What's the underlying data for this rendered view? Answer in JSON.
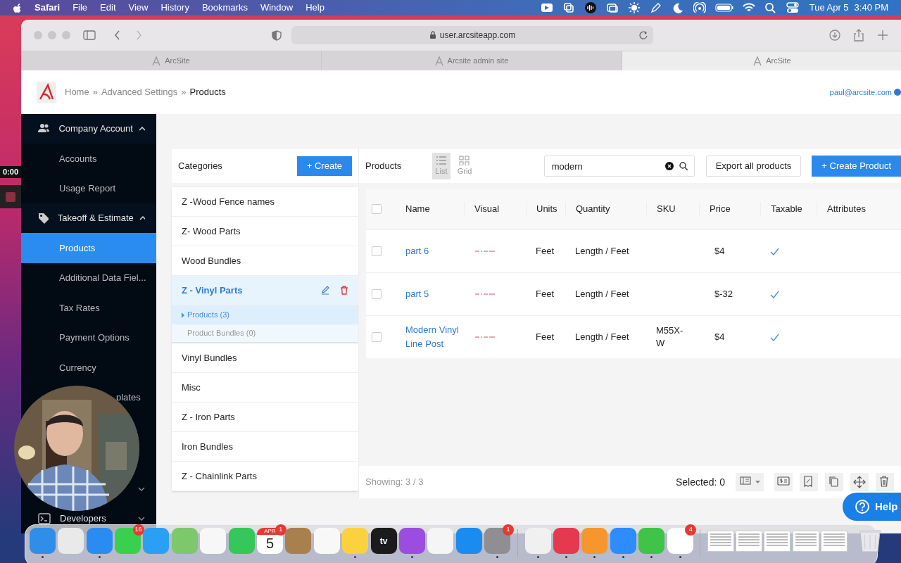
{
  "menu_bar": {
    "app": "Safari",
    "menus": [
      "File",
      "Edit",
      "View",
      "History",
      "Bookmarks",
      "Window",
      "Help"
    ],
    "date": "Tue Apr 5",
    "time": "3:40 PM"
  },
  "browser": {
    "address": "user.arcsiteapp.com",
    "tabs": [
      {
        "label": "ArcSite",
        "selected": false
      },
      {
        "label": "Arcsite admin site",
        "selected": false
      },
      {
        "label": "ArcSite",
        "selected": true
      }
    ]
  },
  "header": {
    "breadcrumb": [
      {
        "label": "Home",
        "current": false
      },
      {
        "label": "Advanced Settings",
        "current": false
      },
      {
        "label": "Products",
        "current": true
      }
    ],
    "separator": "»",
    "user": "paul@arcsite.com"
  },
  "sidebar": {
    "items": [
      {
        "kind": "section",
        "label": "Company Account",
        "expanded": true
      },
      {
        "kind": "link",
        "label": "Accounts",
        "selected": false
      },
      {
        "kind": "link",
        "label": "Usage Report",
        "selected": false
      },
      {
        "kind": "section",
        "label": "Takeoff & Estimate",
        "expanded": true
      },
      {
        "kind": "link",
        "label": "Products",
        "selected": true
      },
      {
        "kind": "link",
        "label": "Additional Data Fiel...",
        "selected": false
      },
      {
        "kind": "link",
        "label": "Tax Rates",
        "selected": false
      },
      {
        "kind": "link",
        "label": "Payment Options",
        "selected": false
      },
      {
        "kind": "link",
        "label": "Currency",
        "selected": false
      },
      {
        "kind": "partial",
        "label": "plates"
      },
      {
        "kind": "section",
        "expanded": false
      },
      {
        "kind": "section",
        "label": "Developers",
        "expanded": false
      }
    ]
  },
  "recorder": {
    "timer": "0:00"
  },
  "categories": {
    "title": "Categories",
    "create_label": "+ Create",
    "items": [
      {
        "label": "Z -Wood Fence names",
        "selected": false
      },
      {
        "label": "Z- Wood Parts",
        "selected": false
      },
      {
        "label": "Wood Bundles",
        "selected": false
      },
      {
        "label": "Z - Vinyl Parts",
        "selected": true,
        "children": [
          {
            "label": "Products (3)",
            "selected": true
          },
          {
            "label": "Product Bundles (0)",
            "selected": false
          }
        ]
      },
      {
        "label": "Vinyl Bundles",
        "selected": false
      },
      {
        "label": "Misc",
        "selected": false
      },
      {
        "label": "Z - Iron Parts",
        "selected": false
      },
      {
        "label": "Iron Bundles",
        "selected": false
      },
      {
        "label": "Z - Chainlink Parts",
        "selected": false
      }
    ]
  },
  "products": {
    "title": "Products",
    "views": [
      {
        "label": "List",
        "selected": true
      },
      {
        "label": "Grid",
        "selected": false
      }
    ],
    "all_checked": false,
    "search": {
      "value": "modern"
    },
    "export_label": "Export all products",
    "create_label": "+ Create Product",
    "columns": [
      "Name",
      "Visual",
      "Units",
      "Quantity",
      "SKU",
      "Price",
      "Taxable",
      "Attributes"
    ],
    "rows": [
      {
        "name": "part 6",
        "checked": false,
        "units": "Feet",
        "quantity": "Length / Feet",
        "price": "$4",
        "taxable": true
      },
      {
        "name": "part 5",
        "checked": false,
        "units": "Feet",
        "quantity": "Length / Feet",
        "price": "$-32",
        "taxable": true
      },
      {
        "name": "Modern Vinyl Line Post",
        "checked": false,
        "units": "Feet",
        "quantity": "Length / Feet",
        "sku": "M55X-W",
        "price": "$4",
        "taxable": true
      }
    ],
    "showing": "Showing: 3 / 3",
    "selected_count": "Selected: 0"
  },
  "help_label": "Help",
  "dock": {
    "apps": [
      {
        "kind": "app",
        "color": "#2f8fe8",
        "running": true
      },
      {
        "kind": "app",
        "color": "#e9e9e9",
        "running": false
      },
      {
        "kind": "app",
        "color": "#2a8cf0",
        "running": true
      },
      {
        "kind": "app",
        "color": "#3ad04f",
        "running": false,
        "badge": "16"
      },
      {
        "kind": "app",
        "color": "#2aa0f5",
        "running": false
      },
      {
        "kind": "app",
        "color": "#7cc86a",
        "running": false
      },
      {
        "kind": "app",
        "color": "#f7f7f7",
        "running": false
      },
      {
        "kind": "app",
        "color": "#35c759",
        "running": false
      },
      {
        "kind": "calendar",
        "month": "APR",
        "day": "5",
        "running": false,
        "badge": "1"
      },
      {
        "kind": "app",
        "color": "#a8804e",
        "running": false
      },
      {
        "kind": "app",
        "color": "#f8f8f8",
        "running": false
      },
      {
        "kind": "app",
        "color": "#fbd23e",
        "running": true
      },
      {
        "kind": "app",
        "color": "#1b1b1b",
        "running": false,
        "label": "tv"
      },
      {
        "kind": "app",
        "color": "#9b4de0",
        "running": true
      },
      {
        "kind": "app",
        "color": "#f5f5f5",
        "running": false
      },
      {
        "kind": "app",
        "color": "#1a8cf0",
        "running": false
      },
      {
        "kind": "app",
        "color": "#8e8e93",
        "running": true,
        "badge": "1"
      },
      {
        "kind": "divider"
      },
      {
        "kind": "app",
        "color": "#f0f0f0",
        "running": true
      },
      {
        "kind": "app",
        "color": "#e63950",
        "running": true
      },
      {
        "kind": "app",
        "color": "#f7962c",
        "running": true
      },
      {
        "kind": "app",
        "color": "#2d8cff",
        "running": true
      },
      {
        "kind": "app",
        "color": "#3fc447",
        "running": true
      },
      {
        "kind": "app",
        "color": "#ffffff",
        "running": true,
        "badge": "4"
      },
      {
        "kind": "divider"
      },
      {
        "kind": "window"
      },
      {
        "kind": "window"
      },
      {
        "kind": "window"
      },
      {
        "kind": "window"
      },
      {
        "kind": "window"
      },
      {
        "kind": "trash"
      }
    ]
  }
}
